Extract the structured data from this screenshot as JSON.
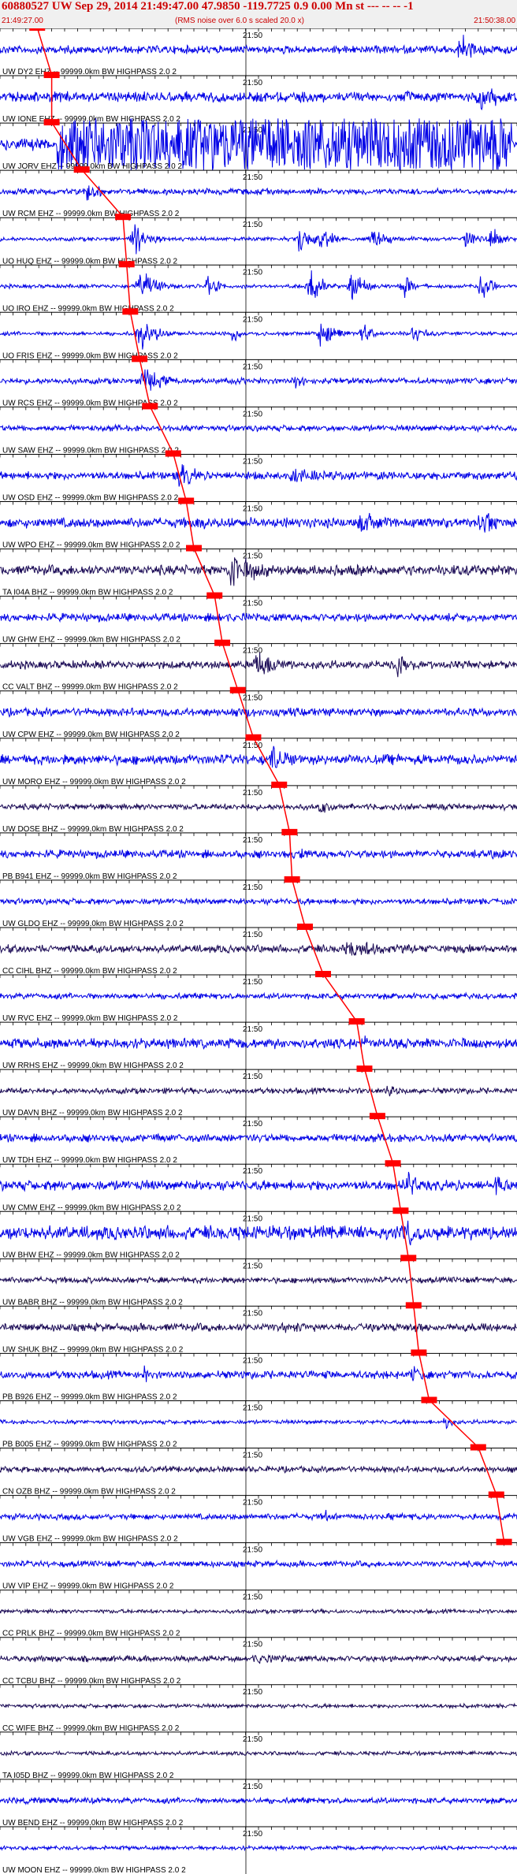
{
  "header": {
    "title": "60880527 UW Sep 29, 2014 21:49:47.00   47.9850 -119.7725  0.9 0.00 Mn st --- -- --   -1",
    "start_time": "21:49:27.00",
    "note": "(RMS noise over 6.0 s scaled 20.0 x)",
    "end_time": "21:50:38.00"
  },
  "chart_data": {
    "type": "line",
    "title": "60880527 UW Sep 29, 2014 21:49:47.00   47.9850 -119.7725  0.9 0.00 Mn st --- -- --   -1",
    "x_range": [
      "21:49:27.00",
      "21:50:38.00"
    ],
    "minute_mark_label": "21:50",
    "grid": true,
    "colors": {
      "blue": "#0000e6",
      "dark": "#1a0a55",
      "pick": "#ff0000",
      "label": "#000000"
    },
    "traces": [
      {
        "label": "UW DY2 EHZ -- 99999.0km BW  HIGHPASS  2.0  2",
        "color": "blue",
        "pick": 0.072,
        "quakes": [
          [
            0.89,
            0.06,
            16
          ]
        ],
        "noise": 4
      },
      {
        "label": "UW IONE EHZ -- 99999.0km BW  HIGHPASS  2.0  2",
        "color": "blue",
        "pick": 0.1,
        "quakes": [
          [
            0.93,
            0.06,
            18
          ]
        ],
        "noise": 5
      },
      {
        "label": "UW JORV EHZ -- 99999.0km BW  HIGHPASS  2.0  2",
        "color": "blue",
        "pick": 0.1,
        "quakes": [],
        "saturated": [
          0.11,
          0.99
        ],
        "noise": 6
      },
      {
        "label": "UW RCM EHZ -- 99999.0km BW  HIGHPASS  2.0  2",
        "color": "blue",
        "pick": 0.158,
        "quakes": [
          [
            0.17,
            0.03,
            14
          ]
        ],
        "noise": 3
      },
      {
        "label": "UO HUQ EHZ -- 99999.0km BW  HIGHPASS  2.0  2",
        "color": "blue",
        "pick": 0.238,
        "quakes": [
          [
            0.26,
            0.05,
            17
          ],
          [
            0.58,
            0.03,
            16
          ],
          [
            0.62,
            0.03,
            16
          ],
          [
            0.72,
            0.04,
            16
          ],
          [
            0.9,
            0.03,
            15
          ],
          [
            0.95,
            0.03,
            15
          ]
        ],
        "noise": 2
      },
      {
        "label": "UO IRO EHZ -- 99999.0km BW  HIGHPASS  2.0  2",
        "color": "blue",
        "pick": 0.245,
        "quakes": [
          [
            0.27,
            0.05,
            18
          ],
          [
            0.4,
            0.03,
            14
          ],
          [
            0.6,
            0.04,
            17
          ],
          [
            0.68,
            0.04,
            16
          ],
          [
            0.78,
            0.03,
            15
          ],
          [
            0.93,
            0.03,
            16
          ]
        ],
        "noise": 2
      },
      {
        "label": "UO FRIS EHZ -- 99999.0km BW  HIGHPASS  2.0  2",
        "color": "blue",
        "pick": 0.252,
        "quakes": [
          [
            0.27,
            0.05,
            18
          ],
          [
            0.45,
            0.02,
            12
          ],
          [
            0.62,
            0.04,
            15
          ],
          [
            0.7,
            0.03,
            14
          ],
          [
            0.8,
            0.03,
            14
          ]
        ],
        "noise": 2
      },
      {
        "label": "UW RCS EHZ -- 99999.0km BW  HIGHPASS  2.0  2",
        "color": "blue",
        "pick": 0.27,
        "quakes": [
          [
            0.28,
            0.05,
            16
          ],
          [
            0.57,
            0.03,
            11
          ]
        ],
        "noise": 3
      },
      {
        "label": "UW SAW EHZ -- 99999.0km BW  HIGHPASS  2.0  2",
        "color": "blue",
        "pick": 0.29,
        "quakes": [],
        "noise": 3
      },
      {
        "label": "UW OSD EHZ -- 99999.0km BW  HIGHPASS  2.0  2",
        "color": "blue",
        "pick": 0.335,
        "quakes": [
          [
            0.35,
            0.04,
            18
          ],
          [
            0.57,
            0.1,
            10
          ]
        ],
        "noise": 4
      },
      {
        "label": "UW WPO EHZ -- 99999.0km BW  HIGHPASS  2.0  2",
        "color": "blue",
        "pick": 0.36,
        "quakes": [
          [
            0.38,
            0.03,
            12
          ],
          [
            0.7,
            0.07,
            14
          ],
          [
            0.93,
            0.04,
            17
          ]
        ],
        "noise": 5
      },
      {
        "label": "TA I04A BHZ -- 99999.0km BW  HIGHPASS  2.0  2",
        "color": "dark",
        "pick": 0.375,
        "quakes": [
          [
            0.45,
            0.1,
            18
          ],
          [
            0.69,
            0.05,
            10
          ]
        ],
        "noise": 5
      },
      {
        "label": "UW GHW EHZ -- 99999.0km BW  HIGHPASS  2.0  2",
        "color": "blue",
        "pick": 0.415,
        "quakes": [
          [
            0.42,
            0.02,
            10
          ]
        ],
        "noise": 4
      },
      {
        "label": "CC VALT BHZ -- 99999.0km BW  HIGHPASS  2.0  2",
        "color": "dark",
        "pick": 0.43,
        "quakes": [
          [
            0.5,
            0.06,
            16
          ],
          [
            0.77,
            0.04,
            16
          ]
        ],
        "noise": 4
      },
      {
        "label": "UW CPW EHZ -- 99999.0km BW  HIGHPASS  2.0  2",
        "color": "blue",
        "pick": 0.46,
        "quakes": [
          [
            0.47,
            0.03,
            11
          ]
        ],
        "noise": 4
      },
      {
        "label": "UW MORO EHZ -- 99999.0km BW  HIGHPASS  2.0  2",
        "color": "blue",
        "pick": 0.49,
        "quakes": [
          [
            0.53,
            0.05,
            16
          ]
        ],
        "noise": 5
      },
      {
        "label": "UW DOSE BHZ -- 99999.0km BW  HIGHPASS  2.0  2",
        "color": "dark",
        "pick": 0.54,
        "quakes": [
          [
            0.62,
            0.03,
            10
          ]
        ],
        "noise": 3
      },
      {
        "label": "PB B941 EHZ -- 99999.0km BW  HIGHPASS  2.0  2",
        "color": "blue",
        "pick": 0.56,
        "quakes": [
          [
            0.58,
            0.02,
            10
          ],
          [
            0.95,
            0.05,
            9
          ]
        ],
        "noise": 4
      },
      {
        "label": "UW GLDO EHZ -- 99999.0km BW  HIGHPASS  2.0  2",
        "color": "blue",
        "pick": 0.565,
        "quakes": [],
        "noise": 3
      },
      {
        "label": "CC CIHL BHZ -- 99999.0km BW  HIGHPASS  2.0  2",
        "color": "dark",
        "pick": 0.59,
        "quakes": [
          [
            0.68,
            0.1,
            12
          ]
        ],
        "noise": 4
      },
      {
        "label": "UW RVC EHZ -- 99999.0km BW  HIGHPASS  2.0  2",
        "color": "blue",
        "pick": 0.625,
        "quakes": [],
        "noise": 3
      },
      {
        "label": "UW RRHS EHZ -- 99999.0km BW  HIGHPASS  2.0  2",
        "color": "blue",
        "pick": 0.69,
        "quakes": [
          [
            0.7,
            0.02,
            14
          ]
        ],
        "noise": 5
      },
      {
        "label": "UW DAVN BHZ -- 99999.0km BW  HIGHPASS  2.0  2",
        "color": "dark",
        "pick": 0.705,
        "quakes": [
          [
            0.75,
            0.04,
            8
          ]
        ],
        "noise": 3
      },
      {
        "label": "UW TDH EHZ -- 99999.0km BW  HIGHPASS  2.0  2",
        "color": "blue",
        "pick": 0.73,
        "quakes": [],
        "noise": 4
      },
      {
        "label": "UW CMW EHZ -- 99999.0km BW  HIGHPASS  2.0  2",
        "color": "blue",
        "pick": 0.76,
        "quakes": [
          [
            0.79,
            0.03,
            18
          ],
          [
            0.96,
            0.02,
            14
          ]
        ],
        "noise": 5
      },
      {
        "label": "UW BHW EHZ -- 99999.0km BW  HIGHPASS  2.0  2",
        "color": "blue",
        "pick": 0.775,
        "quakes": [
          [
            0.79,
            0.02,
            18
          ],
          [
            0.9,
            0.05,
            10
          ]
        ],
        "noise": 7
      },
      {
        "label": "UW BABR BHZ -- 99999.0km BW  HIGHPASS  2.0  2",
        "color": "dark",
        "pick": 0.79,
        "quakes": [],
        "noise": 3
      },
      {
        "label": "UW SHUK BHZ -- 99999.0km BW  HIGHPASS  2.0  2",
        "color": "dark",
        "pick": 0.8,
        "quakes": [
          [
            0.8,
            0.03,
            10
          ],
          [
            0.55,
            0.06,
            8
          ]
        ],
        "noise": 4
      },
      {
        "label": "PB B926 EHZ -- 99999.0km BW  HIGHPASS  2.0  2",
        "color": "blue",
        "pick": 0.81,
        "quakes": [
          [
            0.8,
            0.03,
            15
          ],
          [
            0.28,
            0.01,
            12
          ]
        ],
        "noise": 4
      },
      {
        "label": "PB B005 EHZ -- 99999.0km BW  HIGHPASS  2.0  2",
        "color": "blue",
        "pick": 0.83,
        "quakes": [
          [
            0.86,
            0.03,
            8
          ]
        ],
        "noise": 2
      },
      {
        "label": "CN OZB BHZ -- 99999.0km BW  HIGHPASS  2.0  2",
        "color": "dark",
        "pick": 0.925,
        "quakes": [],
        "noise": 3
      },
      {
        "label": "UW VGB EHZ -- 99999.0km BW  HIGHPASS  2.0  2",
        "color": "blue",
        "pick": 0.96,
        "quakes": [
          [
            0.63,
            0.01,
            8
          ]
        ],
        "noise": 3
      },
      {
        "label": "UW VIP EHZ -- 99999.0km BW  HIGHPASS  2.0  2",
        "color": "blue",
        "pick": 0.975,
        "quakes": [],
        "noise": 3
      },
      {
        "label": "CC PRLK BHZ -- 99999.0km BW  HIGHPASS  2.0  2",
        "color": "dark",
        "pick": null,
        "quakes": [],
        "noise": 2
      },
      {
        "label": "CC TCBU BHZ -- 99999.0km BW  HIGHPASS  2.0  2",
        "color": "dark",
        "pick": null,
        "quakes": [
          [
            0.5,
            0.1,
            6
          ]
        ],
        "noise": 3
      },
      {
        "label": "CC WIFE BHZ -- 99999.0km BW  HIGHPASS  2.0  2",
        "color": "dark",
        "pick": null,
        "quakes": [],
        "noise": 2
      },
      {
        "label": "TA I05D BHZ -- 99999.0km BW  HIGHPASS  2.0  2",
        "color": "dark",
        "pick": null,
        "quakes": [],
        "noise": 2
      },
      {
        "label": "UW BEND EHZ -- 99999.0km BW  HIGHPASS  2.0  2",
        "color": "blue",
        "pick": null,
        "quakes": [],
        "noise": 3
      },
      {
        "label": "UW MOON EHZ -- 99999.0km BW  HIGHPASS  2.0  2",
        "color": "blue",
        "pick": null,
        "quakes": [],
        "noise": 2
      }
    ]
  }
}
